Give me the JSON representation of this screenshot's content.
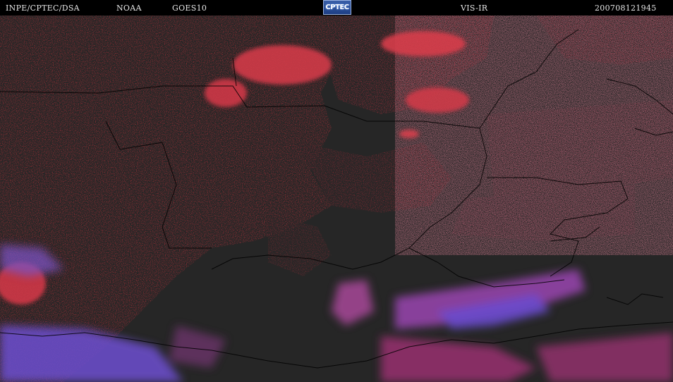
{
  "header": {
    "agency": "INPE/CPTEC/DSA",
    "operator": "NOAA",
    "satellite": "GOES10",
    "logo_text": "CPTEC",
    "channel": "VIS-IR",
    "timestamp": "200708121945"
  },
  "colors": {
    "header_bg": "#000000",
    "cloud_warm_red": "#c8323c",
    "cloud_high_magenta": "#a8337a",
    "cloud_cold_violet": "#6a4cc8",
    "ground_dark": "#262626",
    "border_lines": "#000000"
  }
}
